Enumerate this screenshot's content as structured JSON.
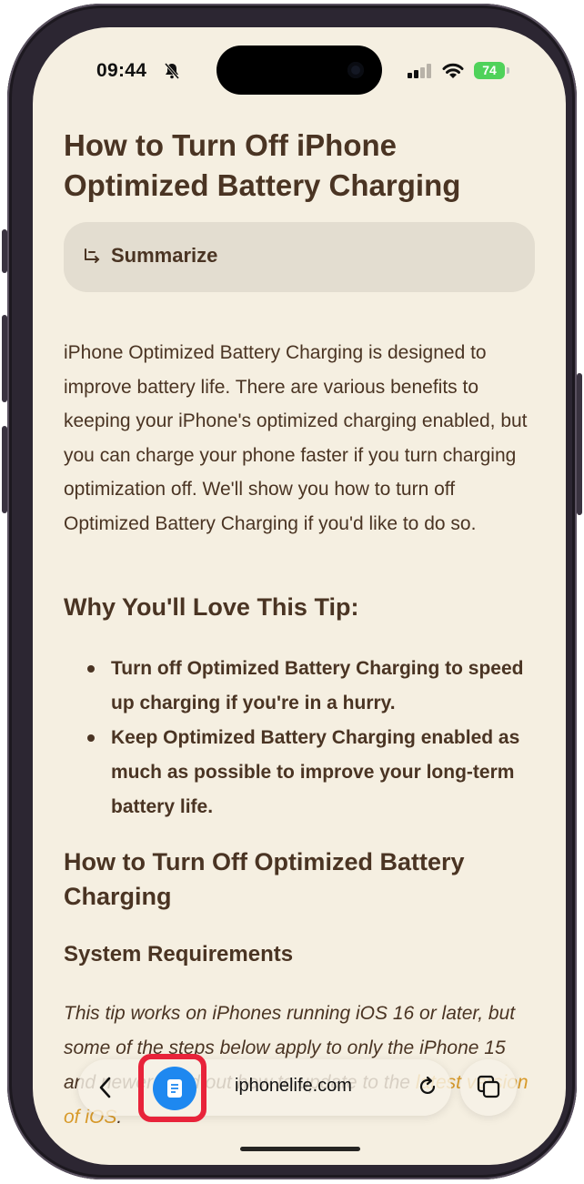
{
  "status": {
    "time": "09:44",
    "battery": "74"
  },
  "article": {
    "title": "How to Turn Off iPhone Optimized Battery Charging",
    "summarize_label": "Summarize",
    "intro": "iPhone Optimized Battery Charging is designed to improve battery life. There are various benefits to keeping your iPhone's optimized charging enabled, but you can charge your phone faster if you turn charging optimization off. We'll show you how to turn off Optimized Battery Charging if you'd like to do so.",
    "why_heading": "Why You'll Love This Tip:",
    "bullets": [
      "Turn off Optimized Battery Charging to speed up charging if you're in a hurry.",
      "Keep Optimized Battery Charging enabled as much as possible to improve your long-term battery life."
    ],
    "howto_heading": "How to Turn Off Optimized Battery Charging",
    "sysreq_heading": "System Requirements",
    "sysreq_text": "This tip works on iPhones running iOS 16 or later, but some of the steps below apply to only the iPhone 15 and newer. Find out how to update to the ",
    "sysreq_link": "latest version of iOS",
    "sysreq_end": "."
  },
  "toolbar": {
    "url": "iphonelife.com"
  },
  "colors": {
    "page_bg": "#f5efe1",
    "text": "#4a3423",
    "accent_blue": "#1e88f0",
    "highlight_red": "#e8233a",
    "link": "#d89a2a"
  },
  "icons": [
    "bell-slash-icon",
    "cellular-signal-icon",
    "wifi-icon",
    "summarize-icon",
    "back-chevron-icon",
    "reader-icon",
    "reload-icon",
    "tabs-icon"
  ]
}
